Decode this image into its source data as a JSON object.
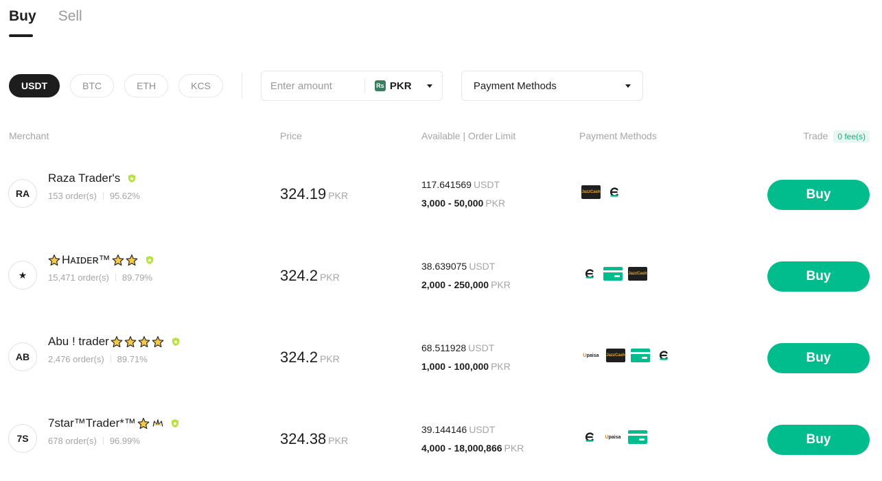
{
  "tabs": [
    {
      "label": "Buy",
      "active": true
    },
    {
      "label": "Sell",
      "active": false
    }
  ],
  "coins": [
    {
      "label": "USDT",
      "active": true
    },
    {
      "label": "BTC",
      "active": false
    },
    {
      "label": "ETH",
      "active": false
    },
    {
      "label": "KCS",
      "active": false
    }
  ],
  "amount": {
    "placeholder": "Enter amount",
    "currency": "PKR",
    "currency_icon": "Rs"
  },
  "payment_filter": {
    "label": "Payment Methods"
  },
  "table_headers": {
    "merchant": "Merchant",
    "price": "Price",
    "available": "Available | Order Limit",
    "payment_methods": "Payment Methods",
    "trade": "Trade",
    "fee_badge": "0 fee(s)"
  },
  "rows": [
    {
      "avatar": "RA",
      "name": "Raza Trader's",
      "stars": 0,
      "orders": "153 order(s)",
      "completion": "95.62%",
      "price": "324.19",
      "price_currency": "PKR",
      "available": "117.641569",
      "available_currency": "USDT",
      "limit": "3,000 - 50,000",
      "limit_currency": "PKR",
      "payment_icons": [
        "jazzcash-icon",
        "easypaisa-icon"
      ],
      "button": "Buy"
    },
    {
      "avatar": "★",
      "name": "Hᴀɪᴅᴇʀ™",
      "stars": 2,
      "orders": "15,471 order(s)",
      "completion": "89.79%",
      "price": "324.2",
      "price_currency": "PKR",
      "available": "38.639075",
      "available_currency": "USDT",
      "limit": "2,000 - 250,000",
      "limit_currency": "PKR",
      "payment_icons": [
        "easypaisa-icon",
        "bank-card-icon",
        "jazzcash-icon"
      ],
      "button": "Buy"
    },
    {
      "avatar": "AB",
      "name": "Abu ! trader",
      "stars": 4,
      "orders": "2,476 order(s)",
      "completion": "89.71%",
      "price": "324.2",
      "price_currency": "PKR",
      "available": "68.511928",
      "available_currency": "USDT",
      "limit": "1,000 - 100,000",
      "limit_currency": "PKR",
      "payment_icons": [
        "upaisa-icon",
        "jazzcash-icon",
        "bank-card-icon",
        "easypaisa-icon"
      ],
      "button": "Buy"
    },
    {
      "avatar": "7S",
      "name": "7star™Trader*™",
      "stars": 1,
      "orders": "678 order(s)",
      "completion": "96.99%",
      "price": "324.38",
      "price_currency": "PKR",
      "available": "39.144146",
      "available_currency": "USDT",
      "limit": "4,000 - 18,000,866",
      "limit_currency": "PKR",
      "payment_icons": [
        "easypaisa-icon",
        "upaisa-icon",
        "bank-card-icon"
      ],
      "button": "Buy"
    }
  ],
  "icon_text": {
    "jazzcash": "JazzCash",
    "upaisa_u": "U",
    "upaisa_rest": "paisa"
  },
  "colors": {
    "accent": "#01bc8d",
    "dark": "#1d1d1d",
    "muted": "#a5a5a5",
    "verified": "#b7e23d"
  }
}
